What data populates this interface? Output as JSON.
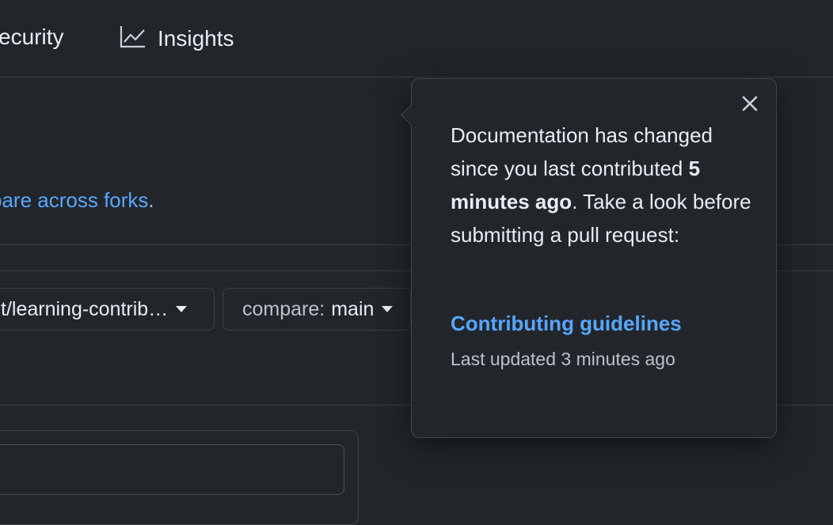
{
  "nav": {
    "security_label": "ecurity",
    "insights_label": "Insights",
    "insights_icon": "graph-icon"
  },
  "compare_text": {
    "link": "pare across forks",
    "suffix": "."
  },
  "branches": {
    "base_label": "t/learning-contrib…",
    "compare_prefix": "compare:",
    "compare_value": "main"
  },
  "popover": {
    "message_line1": "Documentation has changed since you last contributed ",
    "message_emphasis": "5 minutes ago",
    "message_line2": ". Take a look before submitting a pull request:",
    "link_label": "Contributing guidelines",
    "last_updated": "Last updated 3 minutes ago",
    "close_icon": "close-icon"
  },
  "colors": {
    "background": "#22262b",
    "link": "#58a6ff",
    "text": "#e6edf3",
    "muted": "#b9c2cc",
    "border": "#3a3f45"
  }
}
